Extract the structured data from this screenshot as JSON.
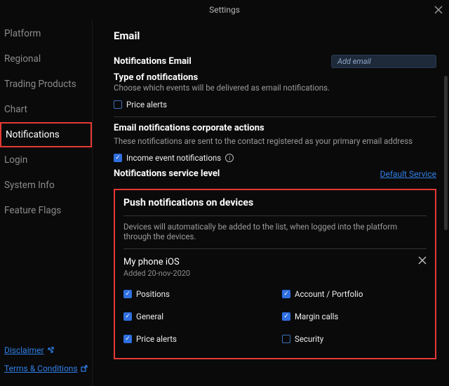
{
  "titlebar": {
    "title": "Settings"
  },
  "sidebar": {
    "items": [
      {
        "label": "Platform"
      },
      {
        "label": "Regional"
      },
      {
        "label": "Trading Products"
      },
      {
        "label": "Chart"
      },
      {
        "label": "Notifications"
      },
      {
        "label": "Login"
      },
      {
        "label": "System Info"
      },
      {
        "label": "Feature Flags"
      }
    ],
    "bottomLinks": {
      "disclaimer": "Disclaimer",
      "terms": "Terms & Conditions"
    }
  },
  "email": {
    "heading": "Email",
    "notifLabel": "Notifications Email",
    "addPlaceholder": "Add email",
    "typeLabel": "Type of notifications",
    "typeDesc": "Choose which events will be delivered as email notifications.",
    "priceAlerts": "Price alerts",
    "corporateHeading": "Email notifications corporate actions",
    "corporateDesc": "These notifications are sent to the contact registered as your primary email address",
    "incomeEvent": "Income event notifications",
    "serviceLabel": "Notifications service level",
    "serviceLink": "Default Service"
  },
  "push": {
    "heading": "Push notifications on devices",
    "desc": "Devices will automatically be added to the list, when logged into the platform through the devices.",
    "device": {
      "name": "My phone iOS",
      "added": "Added 20-nov-2020",
      "opts": {
        "positions": "Positions",
        "account": "Account / Portfolio",
        "general": "General",
        "margin": "Margin calls",
        "price": "Price alerts",
        "security": "Security"
      }
    }
  }
}
